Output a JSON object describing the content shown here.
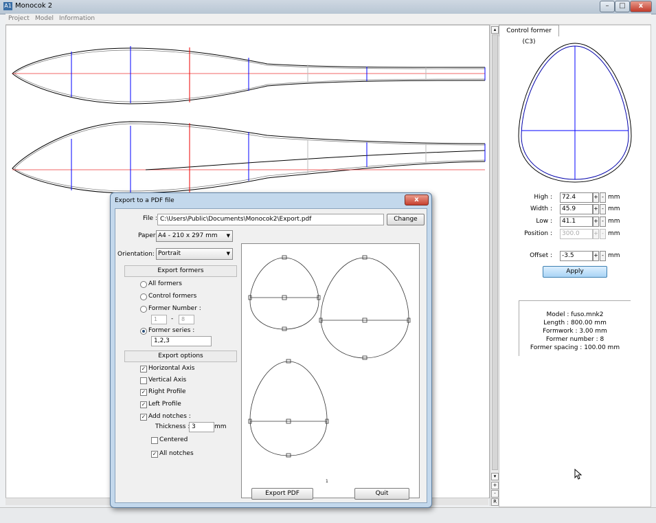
{
  "app": {
    "title": "Monocok 2",
    "icon_text": "A1"
  },
  "window_controls": {
    "minimize": "–",
    "maximize": "□",
    "close": "x"
  },
  "menu": [
    "Project",
    "Model",
    "Information"
  ],
  "scroll": {
    "up": "▴",
    "down": "▾",
    "plus": "+",
    "minus": "-",
    "reset": "R"
  },
  "right_panel": {
    "tab": "Control former (C3)",
    "fields": [
      {
        "label": "High :",
        "value": "72.4",
        "unit": "mm",
        "enabled": true
      },
      {
        "label": "Width :",
        "value": "45.9",
        "unit": "mm",
        "enabled": true
      },
      {
        "label": "Low :",
        "value": "41.1",
        "unit": "mm",
        "enabled": true
      },
      {
        "label": "Position :",
        "value": "300.0",
        "unit": "mm",
        "enabled": false
      },
      {
        "label": "Offset :",
        "value": "-3.5",
        "unit": "mm",
        "enabled": true
      }
    ],
    "plus": "+",
    "minus": "-",
    "apply": "Apply",
    "info": [
      "Model : fuso.mnk2",
      "Length : 800.00 mm",
      "Formwork : 3.00 mm",
      "Former number : 8",
      "Former spacing : 100.00 mm"
    ]
  },
  "dialog": {
    "title": "Export to a PDF file",
    "close": "x",
    "file_label": "File :",
    "file_value": "C:\\Users\\Public\\Documents\\Monocok2\\Export.pdf",
    "change": "Change",
    "paper_label": "Paper :",
    "paper_value": "A4 - 210 x 297 mm",
    "orientation_label": "Orientation:",
    "orientation_value": "Portrait",
    "export_formers": "Export formers",
    "radios": {
      "all": "All formers",
      "control": "Control formers",
      "number": "Former Number :",
      "series": "Former series :"
    },
    "number_from": "1",
    "number_dash": "-",
    "number_to": "8",
    "series_value": "1,2,3",
    "export_options": "Export options",
    "checks": {
      "haxis": "Horizontal Axis",
      "vaxis": "Vertical Axis",
      "rprofile": "Right Profile",
      "lprofile": "Left Profile",
      "notches": "Add notches :",
      "centered": "Centered",
      "allnotches": "All notches"
    },
    "check_mark": "✓",
    "thickness_label": "Thickness :",
    "thickness_value": "3",
    "thickness_unit": "mm",
    "page_number": "1",
    "export_pdf": "Export PDF",
    "quit": "Quit"
  }
}
